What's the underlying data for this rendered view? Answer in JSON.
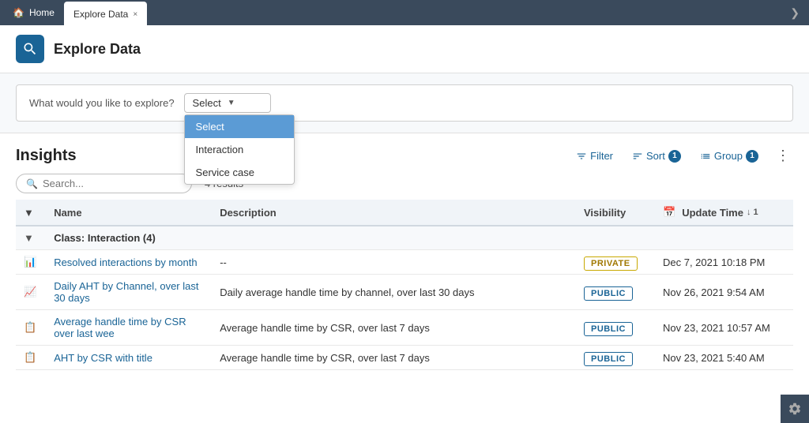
{
  "topNav": {
    "homeTab": "Home",
    "exploreTab": "Explore Data",
    "closeLabel": "×",
    "expandIcon": "❯"
  },
  "pageHeader": {
    "title": "Explore Data"
  },
  "exploreBar": {
    "label": "What would you like to explore?",
    "selectPlaceholder": "Select",
    "dropdownOptions": [
      "Select",
      "Interaction",
      "Service case"
    ]
  },
  "insights": {
    "title": "Insights",
    "resultsCount": "4 results",
    "searchPlaceholder": "Search...",
    "filterLabel": "Filter",
    "sortLabel": "Sort",
    "sortBadge": "1",
    "groupLabel": "Group",
    "groupBadge": "1",
    "tableHeaders": {
      "name": "Name",
      "description": "Description",
      "visibility": "Visibility",
      "updateTime": "Update Time"
    },
    "groupLabel1": "Class:",
    "groupClass": "Interaction (4)",
    "rows": [
      {
        "name": "Resolved interactions by month",
        "description": "--",
        "visibility": "PRIVATE",
        "updateTime": "Dec 7, 2021 10:18 PM",
        "iconType": "bar"
      },
      {
        "name": "Daily AHT by Channel, over last 30 days",
        "description": "Daily average handle time by channel, over last 30 days",
        "visibility": "PUBLIC",
        "updateTime": "Nov 26, 2021 9:54 AM",
        "iconType": "line"
      },
      {
        "name": "Average handle time by CSR over last wee",
        "description": "Average handle time by CSR, over last 7 days",
        "visibility": "PUBLIC",
        "updateTime": "Nov 23, 2021 10:57 AM",
        "iconType": "table"
      },
      {
        "name": "AHT by CSR with title",
        "description": "Average handle time by CSR, over last 7 days",
        "visibility": "PUBLIC",
        "updateTime": "Nov 23, 2021 5:40 AM",
        "iconType": "table"
      }
    ]
  },
  "colors": {
    "accent": "#1a6496",
    "navBg": "#3a4a5c"
  }
}
